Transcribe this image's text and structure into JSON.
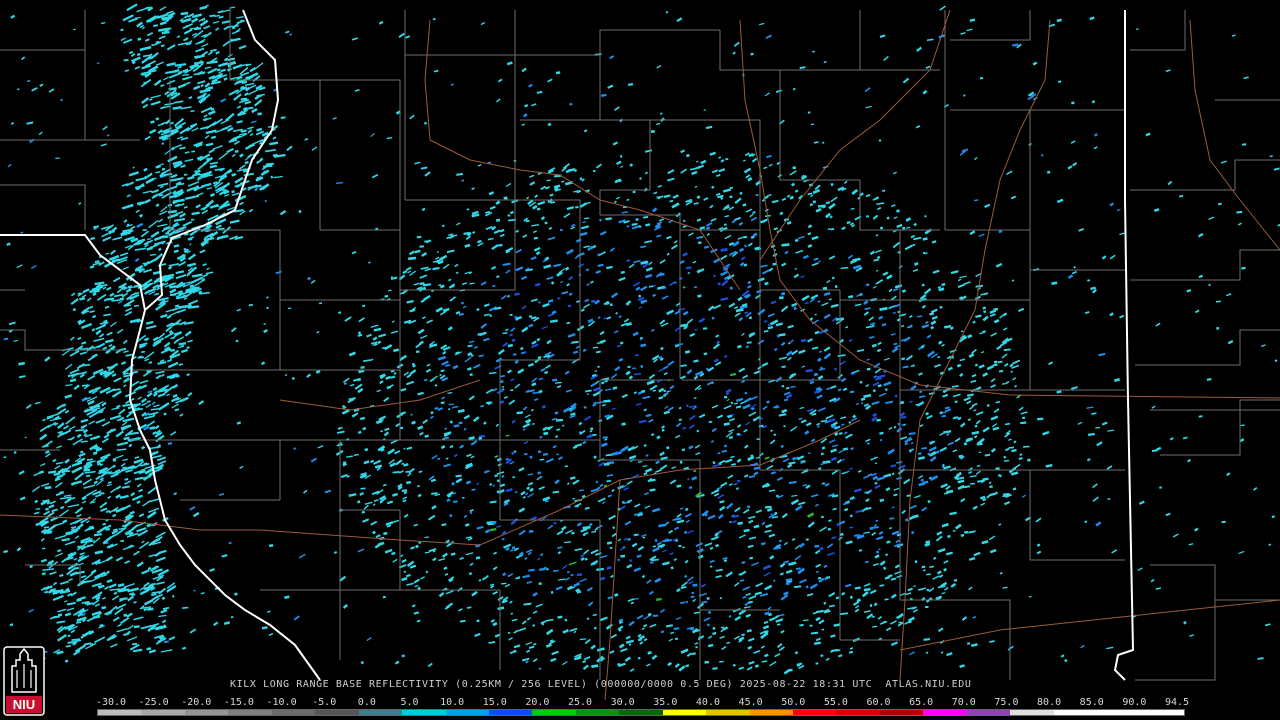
{
  "product": {
    "title": "KILX LONG RANGE BASE REFLECTIVITY (0.25KM / 256 LEVEL) (000000/0000 0.5 DEG) 2025-08-22 18:31 UTC  ATLAS.NIU.EDU"
  },
  "logo": {
    "text": "NIU",
    "color": "#c8102e"
  },
  "colorscale": {
    "labels": [
      "-30.0",
      "-25.0",
      "-20.0",
      "-15.0",
      "-10.0",
      "-5.0",
      "0.0",
      "5.0",
      "10.0",
      "15.0",
      "20.0",
      "25.0",
      "30.0",
      "35.0",
      "40.0",
      "45.0",
      "50.0",
      "55.0",
      "60.0",
      "65.0",
      "70.0",
      "75.0",
      "80.0",
      "85.0",
      "90.0",
      "94.5"
    ],
    "colors": [
      "#bcbcbc",
      "#a8a8a8",
      "#949494",
      "#7f7f7f",
      "#6b6b6b",
      "#565656",
      "#3d7f8f",
      "#00c8e8",
      "#00a0f0",
      "#0050f0",
      "#00d000",
      "#009800",
      "#006800",
      "#ffff00",
      "#e8c000",
      "#ff9000",
      "#ff0000",
      "#d00000",
      "#b00000",
      "#ff00ff",
      "#9040c0",
      "#e0e0e0",
      "#ffffff",
      "#ffffff",
      "#ffffff"
    ]
  },
  "map_colors": {
    "state_border": "#ffffff",
    "county_border": "#6e6e6e",
    "highway": "#9c5a3c",
    "echo_cyan": "#30d8e8",
    "echo_blue": "#1f8ff0",
    "echo_deep_blue": "#1a4fe0",
    "echo_green": "#2ab830"
  }
}
